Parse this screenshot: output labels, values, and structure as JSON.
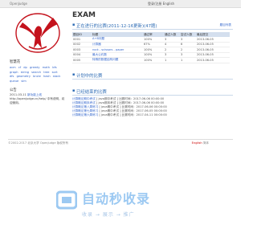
{
  "topbar": {
    "brand": "OpenJudge",
    "login": "登录/注册  English"
  },
  "sidebar": {
    "tags_heading": "智慧花",
    "tags": [
      "acm",
      "cf",
      "dp",
      "greedy",
      "math",
      "bfs",
      "graph",
      "string",
      "search",
      "tree",
      "sort",
      "dfs",
      "geometry",
      "brute",
      "hash",
      "stack",
      "queue",
      "sim"
    ],
    "notice_heading": "公告",
    "notice_date": "2011-03-11",
    "notice_link": "新功能上线",
    "notice_text": "http://openjudge.cn/help/ 中有说明，欢迎使用。"
  },
  "main": {
    "title": "EXAM",
    "current_section": "正在进行的比赛(2011-12-16更新)(47题)",
    "current_link": "题目列表",
    "columns": [
      "题目ID",
      "标题",
      "通过率",
      "通过人数",
      "尝试人数",
      "最后提交"
    ],
    "rows": [
      [
        "0001",
        "A+B问题",
        "100%",
        "3",
        "3",
        "2013-06-05"
      ],
      [
        "0002",
        "计算器",
        "67%",
        "4",
        "6",
        "2013-06-05"
      ],
      [
        "0003",
        "rock - scissors - paper",
        "100%",
        "2",
        "2",
        "2013-06-05"
      ],
      [
        "0004",
        "最大公约数",
        "100%",
        "3",
        "3",
        "2013-06-05"
      ],
      [
        "0005",
        "特殊的数据结构问题",
        "100%",
        "1",
        "1",
        "2013-06-05"
      ]
    ],
    "upcoming_section": "计划中的比赛",
    "past_section": "已经结束的比赛",
    "past_items": [
      {
        "name": "计算概论期中考试",
        "tag": "[ java期中考试 ]",
        "time": "比赛时间：2017-06-06 00:00:00"
      },
      {
        "name": "计算概论期末考试",
        "tag": "[ java期末考试 ]",
        "time": "比赛时间：2017-06-06 00:00:00"
      },
      {
        "name": "计算概论第八周练习",
        "tag": "[ java期中考试 ]",
        "time": "比赛时间：2017-06-06 00:00:00"
      },
      {
        "name": "计算概论第七周练习",
        "tag": "[ java期中考试 ]",
        "time": "比赛时间：2017-06-05 00:00:00"
      },
      {
        "name": "计算概论第六周练习",
        "tag": "[ java期中考试 ]",
        "time": "比赛时间：2017-04-11 00:00:00"
      }
    ]
  },
  "footer": {
    "text": "©2002-2017 北京大学 OpenJudge 版权所有",
    "lang_en": "English",
    "lang_cn": "简体"
  },
  "watermark": {
    "title": "自动秒收录",
    "subtitle": "收录 → 展示 → 推广"
  },
  "colors": {
    "accent": "#2f6db5",
    "link": "#3366cc",
    "header_bg": "#d4dfee",
    "logo_red": "#c4121c"
  }
}
